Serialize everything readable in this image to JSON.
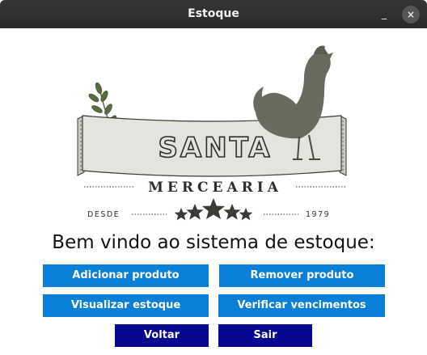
{
  "window": {
    "title": "Estoque",
    "minimize_glyph": "_",
    "close_glyph": "×"
  },
  "logo": {
    "main_text": "SANTA",
    "sub_text": "MERCEARIA",
    "left_caption": "DESDE",
    "right_caption": "1979",
    "icons": [
      "rooster-icon",
      "wheat-sprig-icon",
      "star-icon"
    ],
    "colors": {
      "ink": "#3a3a36",
      "rooster": "#6b6a5e",
      "banner": "#e4e3dd",
      "banner_shade": "#c9c8c1"
    }
  },
  "main": {
    "welcome_text": "Bem vindo ao sistema de estoque:"
  },
  "buttons": {
    "add": "Adicionar produto",
    "remove": "Remover produto",
    "view": "Visualizar estoque",
    "verify": "Verificar vencimentos",
    "back": "Voltar",
    "exit": "Sair"
  },
  "colors": {
    "primary_button": "#0a7fd8",
    "secondary_button": "#06068f",
    "titlebar": "#2f2f2f"
  }
}
